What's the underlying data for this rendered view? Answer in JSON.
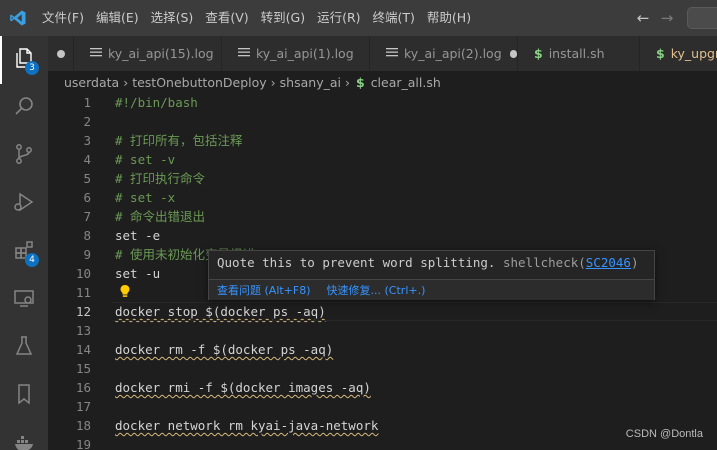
{
  "menu": [
    "文件(F)",
    "编辑(E)",
    "选择(S)",
    "查看(V)",
    "转到(G)",
    "运行(R)",
    "终端(T)",
    "帮助(H)"
  ],
  "activity_badges": {
    "explorer": "3",
    "extensions": "4"
  },
  "tabs": [
    {
      "label": "ky_ai_api(15).log",
      "type": "log"
    },
    {
      "label": "ky_ai_api(1).log",
      "type": "log"
    },
    {
      "label": "ky_ai_api(2).log",
      "type": "log"
    },
    {
      "label": "install.sh",
      "type": "shell"
    },
    {
      "label": "ky_upgr",
      "type": "shell"
    }
  ],
  "breadcrumb": [
    "userdata",
    "testOnebuttonDeploy",
    "shsany_ai",
    "clear_all.sh"
  ],
  "lines": [
    {
      "n": "1",
      "text": "#!/bin/bash"
    },
    {
      "n": "2",
      "text": ""
    },
    {
      "n": "3",
      "text": "# 打印所有，包括注释"
    },
    {
      "n": "4",
      "text": "# set -v"
    },
    {
      "n": "5",
      "text": "# 打印执行命令"
    },
    {
      "n": "6",
      "text": "# set -x"
    },
    {
      "n": "7",
      "text": "# 命令出错退出"
    },
    {
      "n": "8",
      "text": "set -e"
    },
    {
      "n": "9",
      "text": "# 使用未初始化变量报错"
    },
    {
      "n": "10",
      "text": "set -u"
    },
    {
      "n": "11",
      "text": ""
    },
    {
      "n": "12",
      "text": "docker stop $(docker ps -aq)"
    },
    {
      "n": "13",
      "text": ""
    },
    {
      "n": "14",
      "text": "docker rm -f $(docker ps -aq)"
    },
    {
      "n": "15",
      "text": ""
    },
    {
      "n": "16",
      "text": "docker rmi -f $(docker images -aq)"
    },
    {
      "n": "17",
      "text": ""
    },
    {
      "n": "18",
      "text": "docker network rm kyai-java-network"
    },
    {
      "n": "19",
      "text": ""
    }
  ],
  "hover": {
    "message": "Quote this to prevent word splitting.",
    "source": "shellcheck(",
    "rule": "SC2046",
    "source_end": ")",
    "action_view": "查看问题 (Alt+F8)",
    "action_fix": "快速修复... (Ctrl+.)"
  },
  "watermark": "CSDN @Dontla",
  "colors": {
    "accent": "#0e70c0",
    "comment": "#6a9955",
    "string": "#ce9178",
    "link": "#3794ff",
    "squiggle": "#d7ba7d"
  }
}
